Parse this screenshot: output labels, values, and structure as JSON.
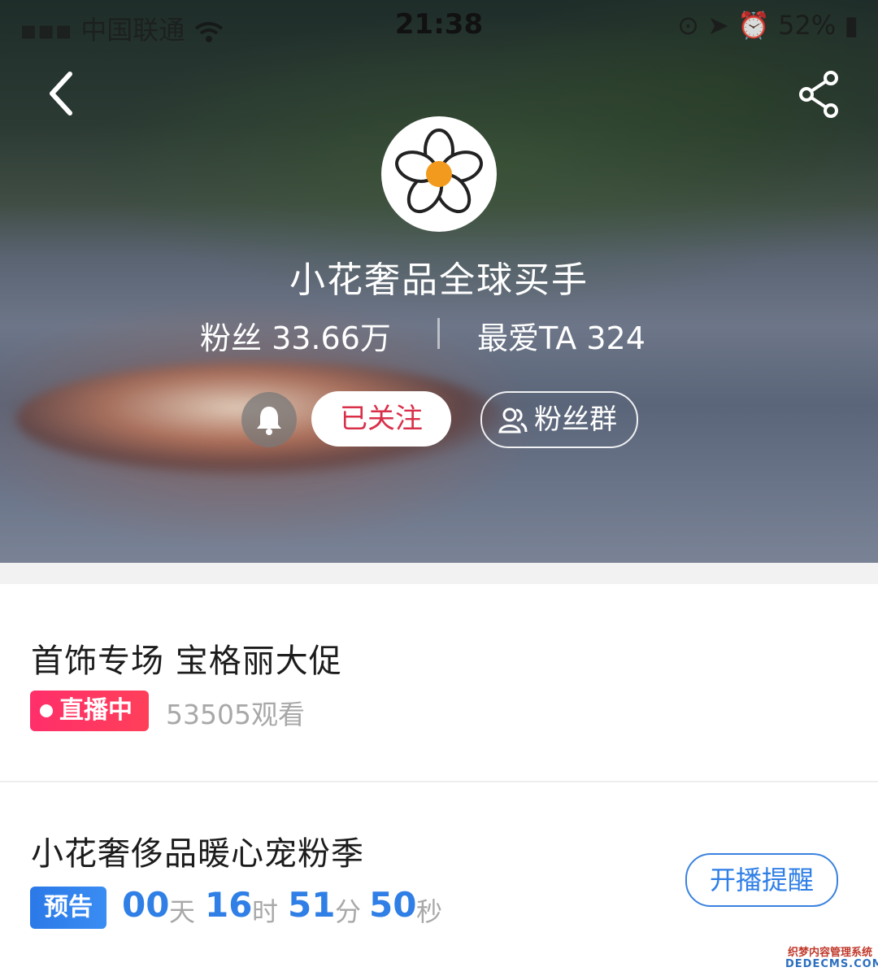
{
  "status_bar": {
    "carrier": "中国联通",
    "time": "21:38",
    "battery": "52%"
  },
  "profile": {
    "name": "小花奢品全球买手",
    "fans_label": "粉丝 33.66万",
    "love_label": "最爱TA 324",
    "follow_label": "已关注",
    "fan_group_label": "粉丝群"
  },
  "live_card": {
    "title": "首饰专场 宝格丽大促",
    "badge": "直播中",
    "views": "53505观看"
  },
  "preview_card": {
    "title": "小花奢侈品暖心宠粉季",
    "badge": "预告",
    "countdown": {
      "days": "00",
      "days_unit": "天",
      "hours": "16",
      "hours_unit": "时",
      "minutes": "51",
      "minutes_unit": "分",
      "seconds": "50",
      "seconds_unit": "秒"
    },
    "remind_label": "开播提醒"
  },
  "watermark": {
    "line1": "织梦内容管理系统",
    "line2": "DEDECMS.COM"
  },
  "colors": {
    "follow_text": "#d9304a",
    "live_badge": "#ff2f6a",
    "preview_badge": "#2b79e8",
    "countdown_number": "#2f7fe6",
    "avatar_center": "#f29a1d"
  },
  "icons": [
    "back-arrow-icon",
    "share-icon",
    "bell-icon",
    "fan-group-icon",
    "live-dot-icon",
    "wifi-icon",
    "location-icon",
    "alarm-icon",
    "battery-icon"
  ]
}
